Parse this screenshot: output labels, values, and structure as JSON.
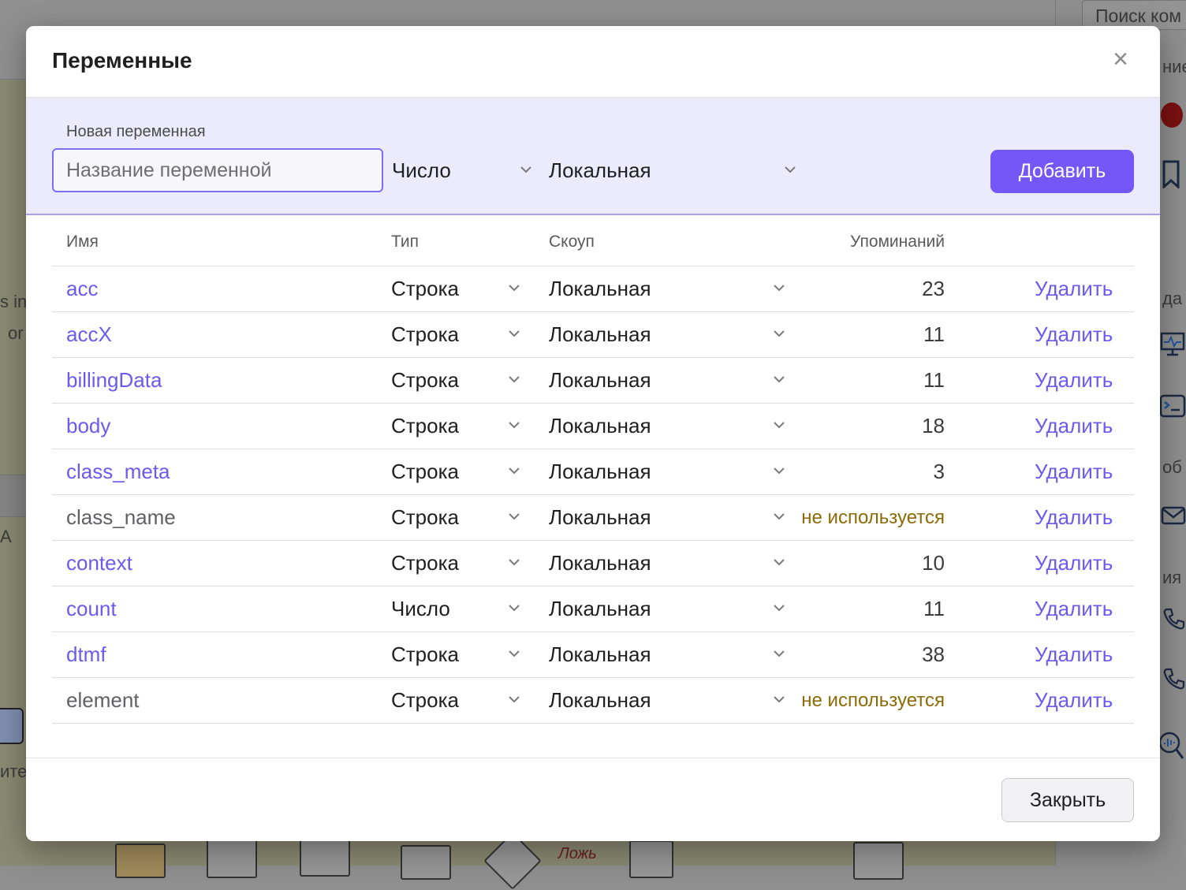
{
  "background": {
    "search_placeholder": "Поиск ком",
    "sidebar_fragments": [
      "ние",
      "да",
      "об",
      "ия"
    ],
    "canvas_fragments": [
      "s in",
      "or",
      "A",
      "ите"
    ],
    "flow_label": "Ложь"
  },
  "modal": {
    "title": "Переменные",
    "close_symbol": "×",
    "new_variable": {
      "label": "Новая переменная",
      "name_placeholder": "Название переменной",
      "name_value": "",
      "type_value": "Число",
      "scope_value": "Локальная",
      "add_button": "Добавить"
    },
    "table": {
      "headers": {
        "name": "Имя",
        "type": "Тип",
        "scope": "Скоуп",
        "mentions": "Упоминаний"
      },
      "delete_label": "Удалить",
      "rows": [
        {
          "name": "acc",
          "type": "Строка",
          "scope": "Локальная",
          "mentions": "23",
          "unused": false
        },
        {
          "name": "accX",
          "type": "Строка",
          "scope": "Локальная",
          "mentions": "11",
          "unused": false
        },
        {
          "name": "billingData",
          "type": "Строка",
          "scope": "Локальная",
          "mentions": "11",
          "unused": false
        },
        {
          "name": "body",
          "type": "Строка",
          "scope": "Локальная",
          "mentions": "18",
          "unused": false
        },
        {
          "name": "class_meta",
          "type": "Строка",
          "scope": "Локальная",
          "mentions": "3",
          "unused": false
        },
        {
          "name": "class_name",
          "type": "Строка",
          "scope": "Локальная",
          "mentions": "не используется",
          "unused": true
        },
        {
          "name": "context",
          "type": "Строка",
          "scope": "Локальная",
          "mentions": "10",
          "unused": false
        },
        {
          "name": "count",
          "type": "Число",
          "scope": "Локальная",
          "mentions": "11",
          "unused": false
        },
        {
          "name": "dtmf",
          "type": "Строка",
          "scope": "Локальная",
          "mentions": "38",
          "unused": false
        },
        {
          "name": "element",
          "type": "Строка",
          "scope": "Локальная",
          "mentions": "не используется",
          "unused": true
        }
      ]
    },
    "footer": {
      "close_button": "Закрыть"
    }
  },
  "colors": {
    "accent": "#7557f7",
    "link": "#6a5af0",
    "unused_text": "#8d6a06",
    "new_var_bg": "#ecebfd"
  }
}
